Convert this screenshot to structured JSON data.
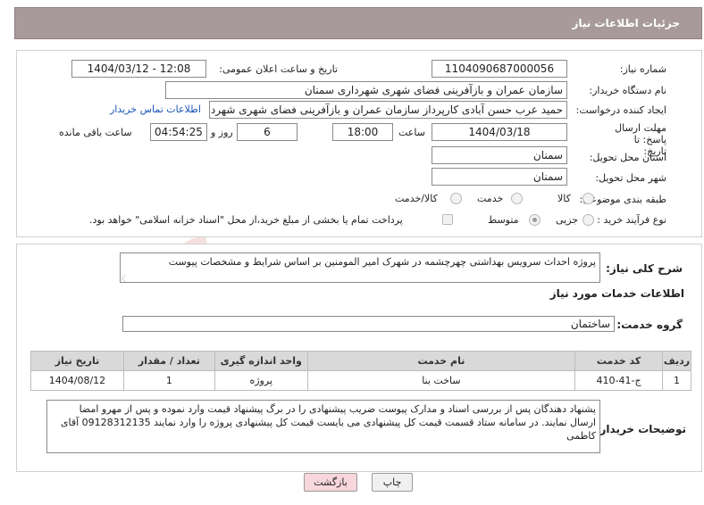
{
  "header": {
    "title": "جزئیات اطلاعات نیاز"
  },
  "fields": {
    "need_number_label": "شماره نیاز:",
    "need_number": "1104090687000056",
    "announce_label": "تاریخ و ساعت اعلان عمومی:",
    "announce_value": "1404/03/12 - 12:08",
    "buyer_org_label": "نام دستگاه خریدار:",
    "buyer_org": "سازمان عمران و بازآفرینی فضای شهری شهرداری سمنان",
    "requester_label": "ایجاد کننده درخواست:",
    "requester": "حمید عرب حسن آبادی کارپرداز سازمان عمران و بازآفرینی فضای شهری شهردار",
    "contact_link": "اطلاعات تماس خریدار",
    "deadline_label": "مهلت ارسال پاسخ: تا تاریخ:",
    "deadline_date": "1404/03/18",
    "time_label": "ساعت",
    "deadline_time": "18:00",
    "days_value": "6",
    "days_label": "روز و",
    "remaining_time": "04:54:25",
    "remaining_label": "ساعت باقی مانده",
    "province_label": "استان محل تحویل:",
    "province": "سمنان",
    "city_label": "شهر محل تحویل:",
    "city": "سمنان",
    "category_label": "طبقه بندی موضوعی:",
    "category_options": [
      "کالا",
      "خدمت",
      "کالا/خدمت"
    ],
    "process_label": "نوع فرآیند خرید :",
    "process_options": [
      "جزیی",
      "متوسط"
    ],
    "payment_note": "پرداخت تمام یا بخشی از مبلغ خرید،از محل \"اسناد خزانه اسلامی\" خواهد بود."
  },
  "summary": {
    "label": "شرح کلی نیاز:",
    "text": "پروژه احداث سرویس بهداشتی چهرچشمه در شهرک امیر المومنین بر اساس شرایط و مشخصات پیوست"
  },
  "services": {
    "section_title": "اطلاعات خدمات مورد نیاز",
    "group_label": "گروه خدمت:",
    "group_value": "ساختمان",
    "columns": [
      "ردیف",
      "کد خدمت",
      "نام خدمت",
      "واحد اندازه گیری",
      "تعداد / مقدار",
      "تاریخ نیاز"
    ],
    "rows": [
      [
        "1",
        "ج-41-410",
        "ساخت بنا",
        "پروژه",
        "1",
        "1404/08/12"
      ]
    ]
  },
  "buyer_notes": {
    "label": "توضیحات خریدار:",
    "text": "پشنهاد دهندگان پس از بررسی اسناد و مدارک پیوست ضریب  پیشنهادی را در برگ پیشنهاد قیمت وارد نموده و پس از مهرو امضا ارسال نمایند. در سامانه ستاد قسمت قیمت کل پیشنهادی می بایست قیمت کل پیشنهادی پروژه را وارد نمایند 09128312135 آقای کاظمی"
  },
  "buttons": {
    "print": "چاپ",
    "back": "بازگشت"
  },
  "watermark": {
    "text": "AriaTender.neT"
  },
  "colors": {
    "header_bg": "#a89a9a",
    "link": "#1a56b8",
    "back_button_bg": "#f7d6dc"
  }
}
